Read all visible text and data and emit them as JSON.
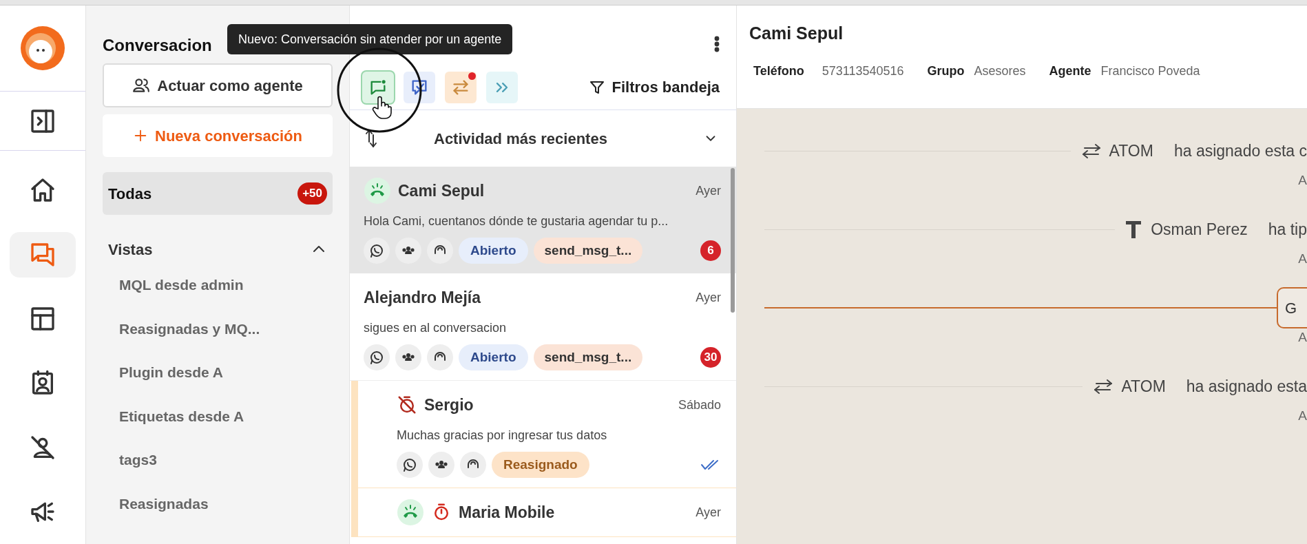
{
  "rail": {
    "items": [
      {
        "kind": "panel",
        "selected": false
      },
      {
        "kind": "home",
        "selected": false
      },
      {
        "kind": "chat",
        "selected": true
      },
      {
        "kind": "table",
        "selected": false
      },
      {
        "kind": "contact",
        "selected": false
      },
      {
        "kind": "mute",
        "selected": false
      },
      {
        "kind": "megaphone",
        "selected": false
      }
    ]
  },
  "tooltip": "Nuevo: Conversación sin atender por un agente",
  "conversations_panel": {
    "title": "Conversacion",
    "act_button": "Actuar como agente",
    "new_button": "Nueva conversación",
    "inbox": {
      "label": "Todas",
      "count": "+50",
      "selected": true
    },
    "views": {
      "title": "Vistas",
      "expanded": true,
      "items": [
        "MQL desde admin",
        "Reasignadas y MQ...",
        "Plugin desde A",
        "Etiquetas desde A",
        "tags3",
        "Reasignadas"
      ]
    }
  },
  "list_panel": {
    "toolbar": [
      {
        "kind": "new",
        "selected": true,
        "notified": false
      },
      {
        "kind": "read",
        "selected": false,
        "notified": false
      },
      {
        "kind": "transfer",
        "selected": false,
        "notified": true
      },
      {
        "kind": "forward",
        "selected": false,
        "notified": false
      }
    ],
    "filters_button": "Filtros bandeja",
    "sort": "Actividad más recientes",
    "conversations": [
      {
        "name": "Cami Sepul",
        "time": "Ayer",
        "preview": "Hola Cami, cuentanos dónde te gustaria agendar tu p...",
        "icons": [
          {
            "kind": "call"
          }
        ],
        "status": {
          "text": "Abierto",
          "kind": "open"
        },
        "tag": "send_msg_t...",
        "unread": "6",
        "read": false,
        "selected": true,
        "highlighted": false
      },
      {
        "name": "Alejandro Mejía",
        "time": "Ayer",
        "preview": "sigues en al conversacion",
        "status": {
          "text": "Abierto",
          "kind": "open"
        },
        "tag": "send_msg_t...",
        "unread": "30",
        "read": false,
        "selected": false,
        "highlighted": false
      },
      {
        "name": "Sergio",
        "time": "Sábado",
        "preview": "Muchas gracias por ingresar tus datos",
        "icons": [
          {
            "kind": "timer_off"
          }
        ],
        "status": {
          "text": "Reasignado",
          "kind": "reassigned"
        },
        "read": true,
        "selected": false,
        "highlighted": true
      },
      {
        "name": "Maria Mobile",
        "time": "Ayer",
        "icons": [
          {
            "kind": "call"
          },
          {
            "kind": "timer"
          }
        ],
        "selected": false,
        "highlighted": true
      }
    ]
  },
  "chat": {
    "name": "Cami Sepul",
    "fields": [
      {
        "label": "Teléfono",
        "value": "573113540516"
      },
      {
        "label": "Grupo",
        "value": "Asesores"
      },
      {
        "label": "Agente",
        "value": "Francisco Poveda"
      }
    ],
    "events": [
      {
        "kind": "assign",
        "actor": "ATOM",
        "text": "ha asignado esta c",
        "time": "A"
      },
      {
        "kind": "type",
        "actor": "Osman Perez",
        "text": "ha tip",
        "time": "A"
      },
      {
        "kind": "marker",
        "label": "G",
        "time": "A"
      },
      {
        "kind": "assign",
        "actor": "ATOM",
        "text": "ha asignado esta",
        "time": "A"
      }
    ]
  }
}
